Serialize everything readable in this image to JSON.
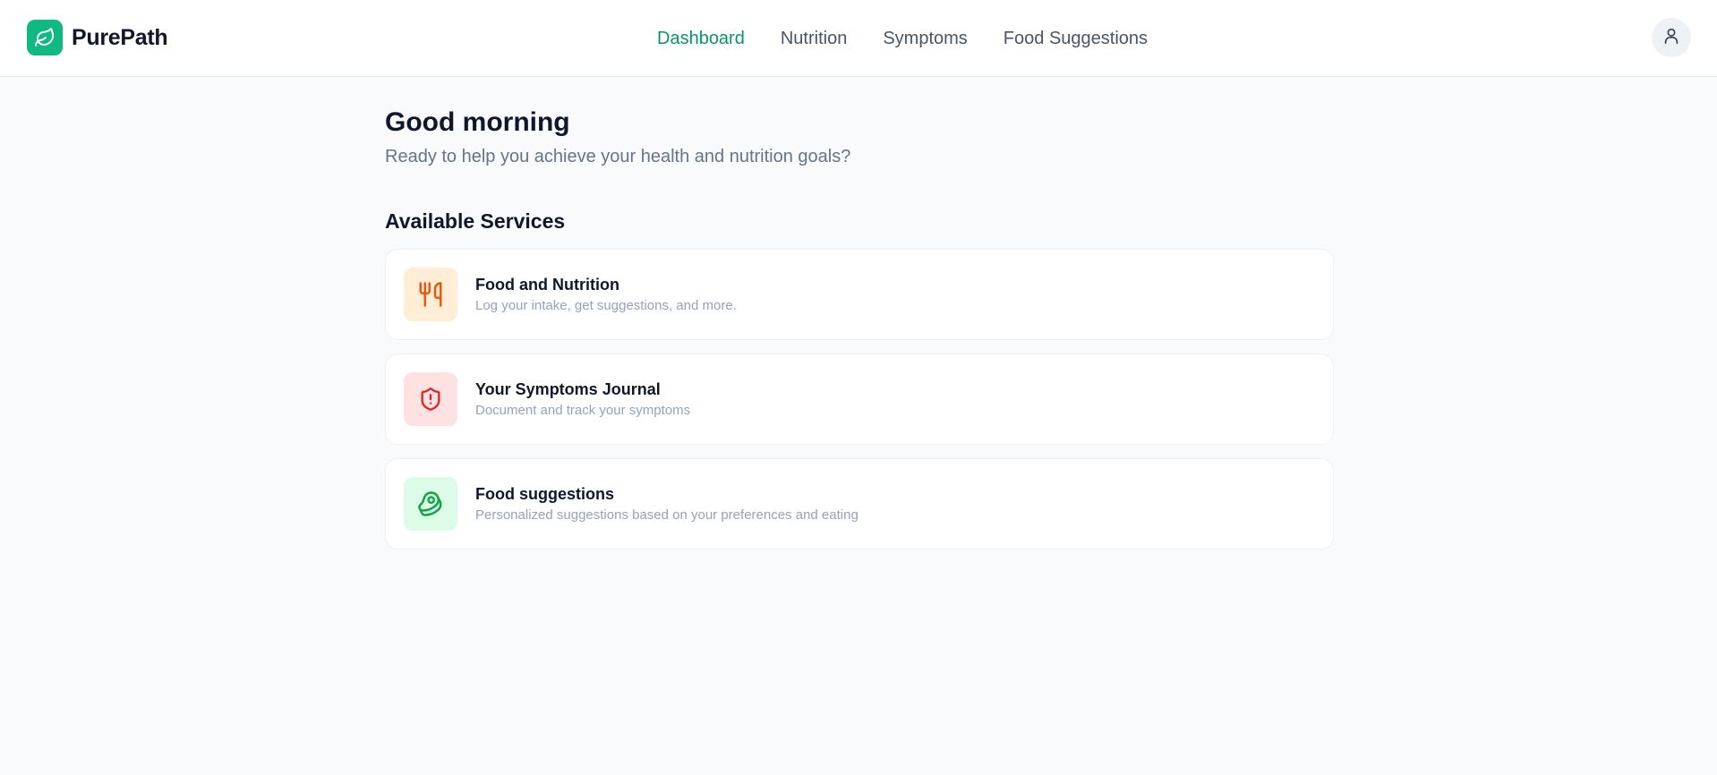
{
  "brand": {
    "name": "PurePath",
    "logo_icon": "leaf-icon",
    "accent_color": "#10b981"
  },
  "nav": {
    "items": [
      {
        "label": "Dashboard",
        "active": true
      },
      {
        "label": "Nutrition",
        "active": false
      },
      {
        "label": "Symptoms",
        "active": false
      },
      {
        "label": "Food Suggestions",
        "active": false
      }
    ],
    "active_color": "#059669"
  },
  "user": {
    "avatar_icon": "user-icon"
  },
  "main": {
    "greeting": "Good morning",
    "subtitle": "Ready to help you achieve your health and nutrition goals?",
    "section_title": "Available Services",
    "services": [
      {
        "title": "Food and Nutrition",
        "description": "Log your intake, get suggestions, and more.",
        "icon": "fork-knife-icon",
        "icon_bg": "#ffedd5",
        "icon_color": "#ea580c"
      },
      {
        "title": "Your Symptoms Journal",
        "description": "Document and track your symptoms",
        "icon": "shield-alert-icon",
        "icon_bg": "#fee2e2",
        "icon_color": "#dc2626"
      },
      {
        "title": "Food suggestions",
        "description": "Personalized suggestions based on your preferences and eating",
        "icon": "beef-icon",
        "icon_bg": "#dcfce7",
        "icon_color": "#16a34a"
      }
    ]
  }
}
